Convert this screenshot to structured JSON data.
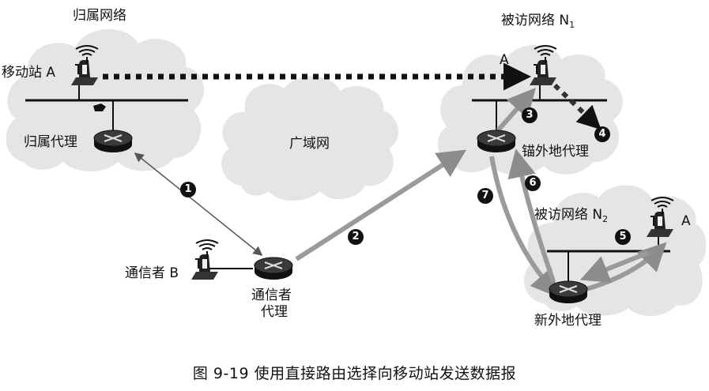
{
  "labels": {
    "home_network": "归属网络",
    "mobile_station": "移动站 A",
    "home_agent": "归属代理",
    "wan": "广域网",
    "visited_network_1_main": "被访网络 N",
    "visited_network_1_sub": "1",
    "station_at_n1": "A",
    "anchor_foreign_agent": "锚外地代理",
    "visited_network_2_main": "被访网络 N",
    "visited_network_2_sub": "2",
    "station_at_n2": "A",
    "correspondent_b": "通信者 B",
    "correspondent_agent_line1": "通信者",
    "correspondent_agent_line2": "代理",
    "new_foreign_agent": "新外地代理"
  },
  "steps": [
    "1",
    "2",
    "3",
    "4",
    "5",
    "6",
    "7"
  ],
  "caption": "图 9-19 使用直接路由选择向移动站发送数据报",
  "colors": {
    "cloud": "#e6e6e6",
    "flow_arrow": "#9a9a9a",
    "dotted_path": "#111111",
    "router": "#222222"
  }
}
